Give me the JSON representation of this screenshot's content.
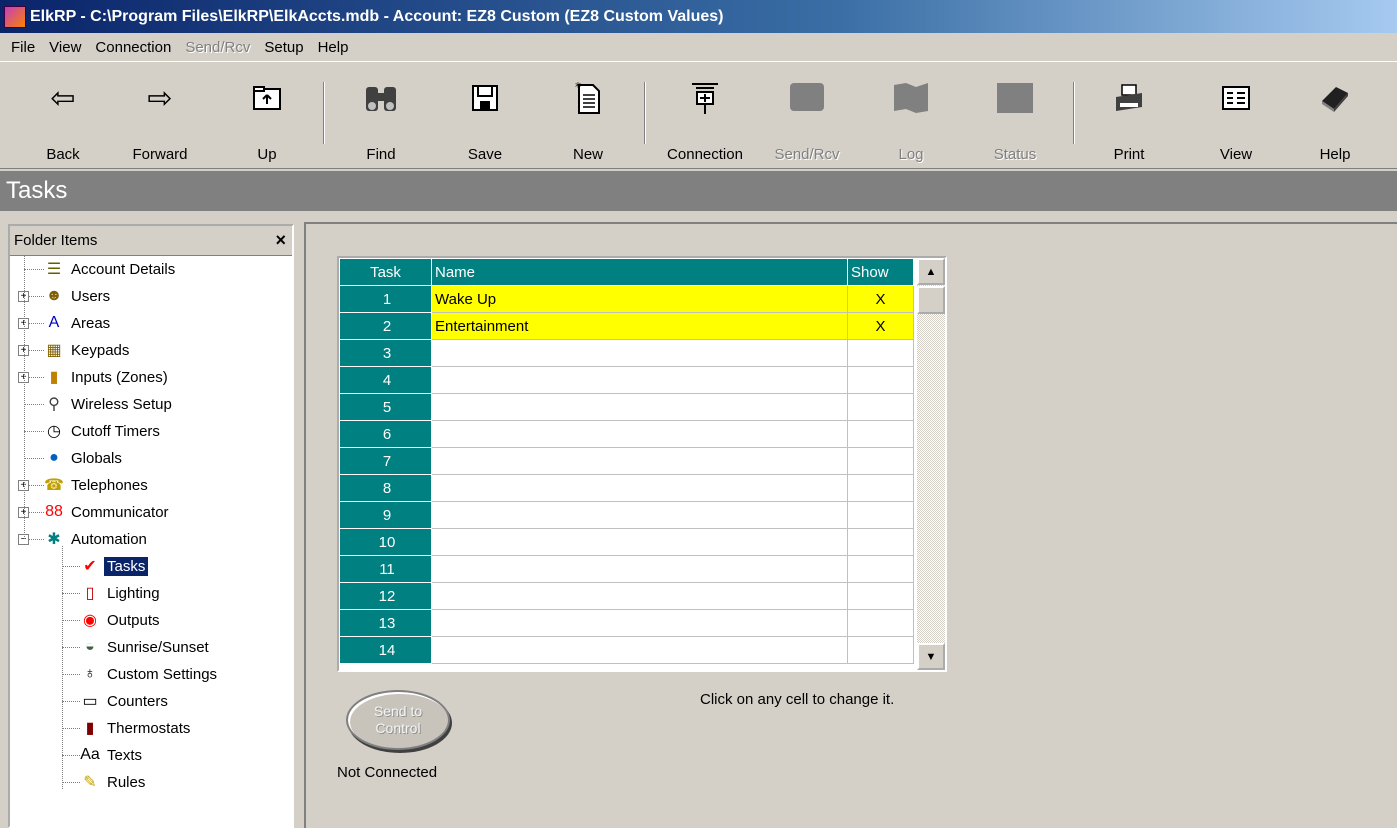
{
  "window": {
    "title": "ElkRP - C:\\Program Files\\ElkRP\\ElkAccts.mdb - Account: EZ8 Custom (EZ8 Custom Values)"
  },
  "menu": {
    "file": "File",
    "view": "View",
    "connection": "Connection",
    "sendrcv": "Send/Rcv",
    "setup": "Setup",
    "help": "Help"
  },
  "toolbar": {
    "back": "Back",
    "forward": "Forward",
    "up": "Up",
    "find": "Find",
    "save": "Save",
    "new": "New",
    "connection": "Connection",
    "sendrcv": "Send/Rcv",
    "log": "Log",
    "status": "Status",
    "print": "Print",
    "view": "View",
    "help": "Help"
  },
  "section": {
    "title": "Tasks"
  },
  "folder": {
    "header": "Folder Items",
    "close": "×",
    "items": [
      {
        "label": "Account Details",
        "icon": "account-details-icon",
        "glyph": "☰",
        "color": "#606000",
        "expandable": false
      },
      {
        "label": "Users",
        "icon": "users-icon",
        "glyph": "☻",
        "color": "#806000",
        "expandable": true
      },
      {
        "label": "Areas",
        "icon": "areas-icon",
        "glyph": "A",
        "color": "#0000c0",
        "expandable": true
      },
      {
        "label": "Keypads",
        "icon": "keypads-icon",
        "glyph": "▦",
        "color": "#806000",
        "expandable": true
      },
      {
        "label": "Inputs (Zones)",
        "icon": "inputs-icon",
        "glyph": "▮",
        "color": "#c08000",
        "expandable": true
      },
      {
        "label": "Wireless Setup",
        "icon": "wireless-icon",
        "glyph": "⚲",
        "color": "#404040",
        "expandable": false
      },
      {
        "label": "Cutoff Timers",
        "icon": "timer-icon",
        "glyph": "◷",
        "color": "#000000",
        "expandable": false
      },
      {
        "label": "Globals",
        "icon": "globe-icon",
        "glyph": "●",
        "color": "#0060c0",
        "expandable": false
      },
      {
        "label": "Telephones",
        "icon": "telephone-icon",
        "glyph": "☎",
        "color": "#c0a000",
        "expandable": true
      },
      {
        "label": "Communicator",
        "icon": "communicator-icon",
        "glyph": "88",
        "color": "#ff0000",
        "expandable": true
      },
      {
        "label": "Automation",
        "icon": "automation-icon",
        "glyph": "✱",
        "color": "#008080",
        "expandable": true,
        "expanded": true
      },
      {
        "label": "Tasks",
        "icon": "tasks-icon",
        "glyph": "✔",
        "color": "#ff0000",
        "expandable": false,
        "child": true,
        "selected": true
      },
      {
        "label": "Lighting",
        "icon": "lighting-icon",
        "glyph": "▯",
        "color": "#c00000",
        "expandable": false,
        "child": true
      },
      {
        "label": "Outputs",
        "icon": "outputs-icon",
        "glyph": "◉",
        "color": "#ff0000",
        "expandable": false,
        "child": true
      },
      {
        "label": "Sunrise/Sunset",
        "icon": "sunrise-icon",
        "glyph": "◒",
        "color": "#406040",
        "expandable": false,
        "child": true
      },
      {
        "label": "Custom Settings",
        "icon": "custom-settings-icon",
        "glyph": "♁",
        "color": "#000000",
        "expandable": false,
        "child": true
      },
      {
        "label": "Counters",
        "icon": "counters-icon",
        "glyph": "▭",
        "color": "#000000",
        "expandable": false,
        "child": true
      },
      {
        "label": "Thermostats",
        "icon": "thermostat-icon",
        "glyph": "▮",
        "color": "#800000",
        "expandable": false,
        "child": true
      },
      {
        "label": "Texts",
        "icon": "texts-icon",
        "glyph": "Aa",
        "color": "#000000",
        "expandable": false,
        "child": true
      },
      {
        "label": "Rules",
        "icon": "rules-icon",
        "glyph": "✎",
        "color": "#c0a000",
        "expandable": false,
        "child": true
      }
    ]
  },
  "grid": {
    "headers": {
      "task": "Task",
      "name": "Name",
      "show": "Show"
    },
    "rows": [
      {
        "task": "1",
        "name": "Wake Up",
        "show": "X"
      },
      {
        "task": "2",
        "name": "Entertainment",
        "show": "X"
      },
      {
        "task": "3",
        "name": "",
        "show": ""
      },
      {
        "task": "4",
        "name": "",
        "show": ""
      },
      {
        "task": "5",
        "name": "",
        "show": ""
      },
      {
        "task": "6",
        "name": "",
        "show": ""
      },
      {
        "task": "7",
        "name": "",
        "show": ""
      },
      {
        "task": "8",
        "name": "",
        "show": ""
      },
      {
        "task": "9",
        "name": "",
        "show": ""
      },
      {
        "task": "10",
        "name": "",
        "show": ""
      },
      {
        "task": "11",
        "name": "",
        "show": ""
      },
      {
        "task": "12",
        "name": "",
        "show": ""
      },
      {
        "task": "13",
        "name": "",
        "show": ""
      },
      {
        "task": "14",
        "name": "",
        "show": ""
      }
    ]
  },
  "hint": "Click on any cell to change it.",
  "send_button": "Send to\nControl",
  "connection_status": "Not Connected"
}
